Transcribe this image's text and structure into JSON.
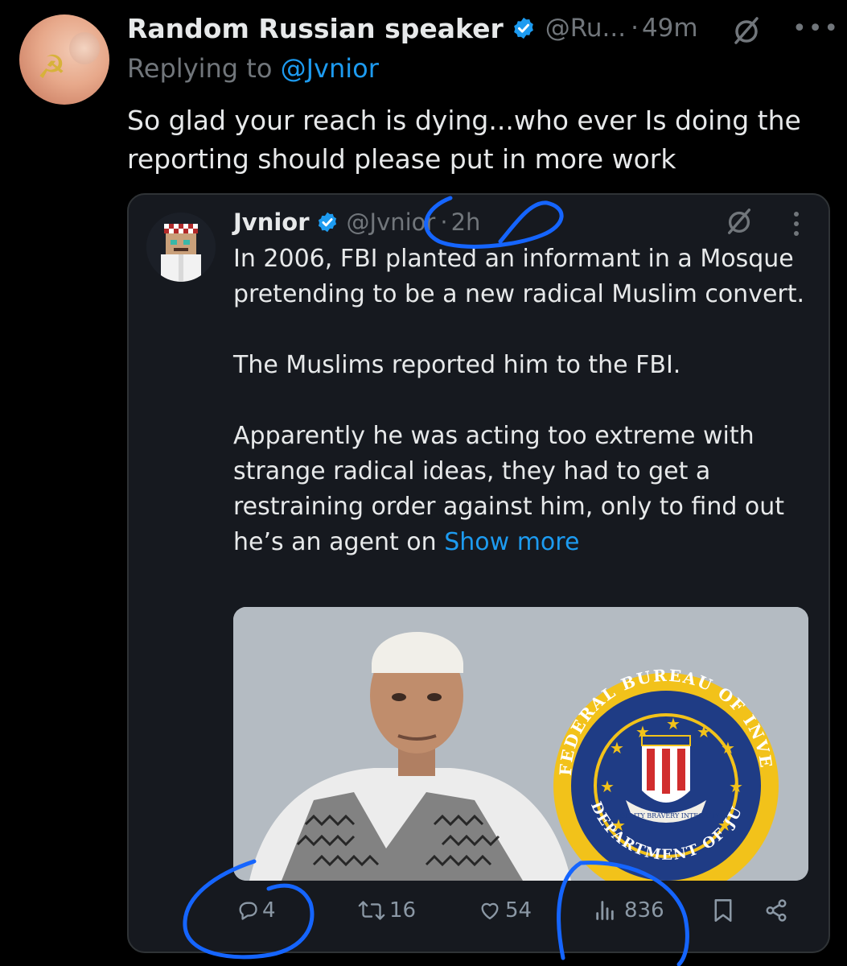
{
  "reply": {
    "author": {
      "name": "Random Russian speaker",
      "handle": "@Ru...",
      "time": "49m",
      "separator": "·"
    },
    "replying_to": {
      "prefix": "Replying to",
      "handle": "@Jvnior"
    },
    "text": "So glad your reach is dying...who ever Is doing the reporting should please put in more work"
  },
  "quoted": {
    "author": {
      "name": "Jvnior",
      "handle": "@Jvnior",
      "time": "2h",
      "separator": "·"
    },
    "paragraphs": [
      "In 2006, FBI planted an informant in a Mosque pretending to be a new radical Muslim convert.",
      "The Muslims reported him to the FBI.",
      "Apparently he was acting too extreme with strange radical ideas, they had to get a restraining order against him, only to find out he’s an agent on"
    ],
    "show_more": "Show more",
    "image": {
      "seal_text_top": "FEDERAL BUREAU OF INVESTIGATION",
      "seal_text_bottom": "DEPARTMENT OF JUSTICE",
      "seal_scroll": "FIDELITY BRAVERY INTEGRITY"
    },
    "stats": {
      "replies": "4",
      "reposts": "16",
      "likes": "54",
      "views": "836"
    }
  },
  "icons": [
    "verified-icon",
    "grok-icon",
    "more-icon",
    "reply-icon",
    "repost-icon",
    "like-icon",
    "views-icon",
    "bookmark-icon",
    "share-icon"
  ],
  "colors": {
    "background": "#000000",
    "card": "#16191f",
    "text": "#e7e9ea",
    "muted": "#71767b",
    "link": "#1d9bf0",
    "annotation": "#1565ff"
  }
}
